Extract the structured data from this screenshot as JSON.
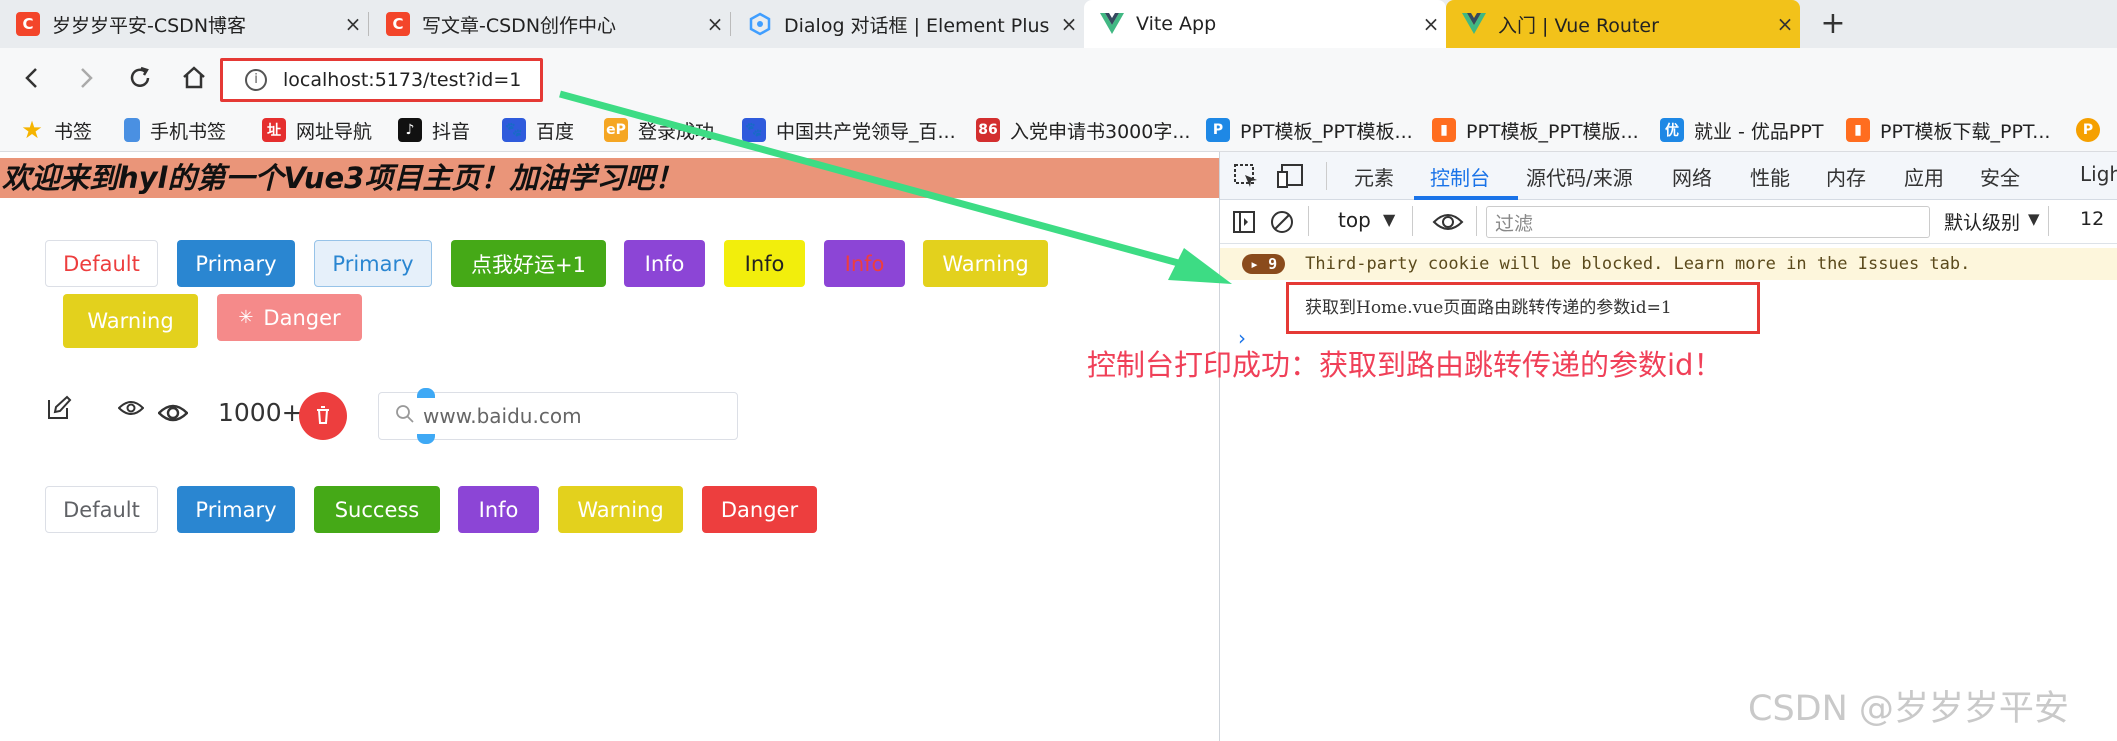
{
  "tabs": [
    {
      "title": "岁岁岁平安-CSDN博客",
      "favicon": "csdn-icon",
      "color": "#f3452a"
    },
    {
      "title": "写文章-CSDN创作中心",
      "favicon": "csdn-icon",
      "color": "#f3452a"
    },
    {
      "title": "Dialog 对话框 | Element Plus",
      "favicon": "element-plus-icon",
      "color": "#409eff"
    },
    {
      "title": "Vite App",
      "favicon": "vue-icon",
      "color": "#41b883"
    },
    {
      "title": "入门 | Vue Router",
      "favicon": "vue-icon",
      "color": "#41b883"
    }
  ],
  "tab_close": "×",
  "new_tab": "+",
  "address": {
    "url": "localhost:5173/test?id=1"
  },
  "bookmarks": [
    {
      "label": "书签",
      "icon": "star-icon"
    },
    {
      "label": "手机书签",
      "icon": "phone-icon"
    },
    {
      "label": "网址导航",
      "icon": "site-nav-icon"
    },
    {
      "label": "抖音",
      "icon": "douyin-icon"
    },
    {
      "label": "百度",
      "icon": "baidu-icon"
    },
    {
      "label": "登录成功",
      "icon": "ep-icon"
    },
    {
      "label": "中国共产党领导_百...",
      "icon": "baidu-icon"
    },
    {
      "label": "入党申请书3000字...",
      "icon": "86-icon"
    },
    {
      "label": "PPT模板_PPT模板...",
      "icon": "ppt-icon"
    },
    {
      "label": "PPT模板_PPT模版...",
      "icon": "ppt-icon"
    },
    {
      "label": "就业 - 优品PPT",
      "icon": "youpin-icon"
    },
    {
      "label": "PPT模板下载_PPT...",
      "icon": "ppt-icon"
    }
  ],
  "page": {
    "banner": "欢迎来到hyl的第一个Vue3项目主页！加油学习吧！",
    "row1": [
      "Default",
      "Primary",
      "Primary",
      "点我好运+1",
      "Info",
      "Info",
      "Info",
      "Warning",
      "Warning",
      "Danger"
    ],
    "count_text": "1000+",
    "search": {
      "placeholder": "www.baidu.com"
    },
    "row3": [
      "Default",
      "Primary",
      "Success",
      "Info",
      "Warning",
      "Danger"
    ]
  },
  "devtools": {
    "tabs": [
      "元素",
      "控制台",
      "源代码/来源",
      "网络",
      "性能",
      "内存",
      "应用",
      "安全",
      "Ligh"
    ],
    "active_tab": "控制台",
    "context": "top",
    "filter_placeholder": "过滤",
    "level": "默认级别",
    "issues_count": "12",
    "warn_badge": "9",
    "warn_text": "Third-party cookie will be blocked. Learn more in the Issues tab.",
    "log": "获取到Home.vue页面路由跳转传递的参数id=1",
    "prompt": "›"
  },
  "annotation": "控制台打印成功：获取到路由跳转传递的参数id！",
  "watermark": "CSDN @岁岁岁平安",
  "colors": {
    "primary": "#2a86d1",
    "success": "#45a917",
    "info": "#8c45d6",
    "warning": "#e3d11d",
    "danger": "#ed3e3e",
    "arrow": "#3ddc84"
  }
}
